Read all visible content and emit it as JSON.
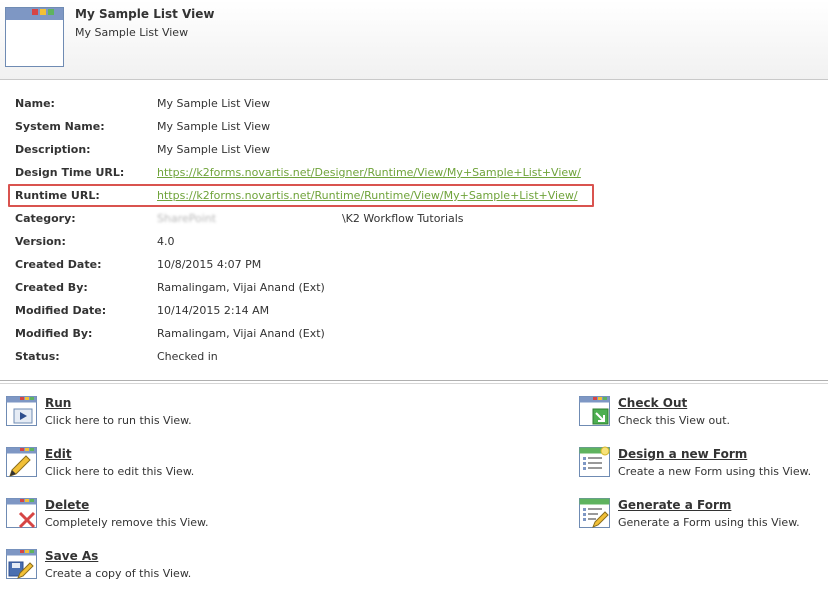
{
  "header": {
    "title": "My Sample List View",
    "subtitle": "My Sample List View"
  },
  "properties": {
    "name": {
      "label": "Name:",
      "value": "My Sample List View"
    },
    "system_name": {
      "label": "System Name:",
      "value": "My Sample List View"
    },
    "description": {
      "label": "Description:",
      "value": "My Sample List View"
    },
    "design_time_url": {
      "label": "Design Time URL:",
      "value": "https://k2forms.novartis.net/Designer/Runtime/View/My+Sample+List+View/"
    },
    "runtime_url": {
      "label": "Runtime URL:",
      "value": "https://k2forms.novartis.net/Runtime/Runtime/View/My+Sample+List+View/"
    },
    "category": {
      "label": "Category:",
      "value_suffix": "\\K2 Workflow Tutorials"
    },
    "version": {
      "label": "Version:",
      "value": "4.0"
    },
    "created_date": {
      "label": "Created Date:",
      "value": "10/8/2015 4:07 PM"
    },
    "created_by": {
      "label": "Created By:",
      "value": "Ramalingam, Vijai Anand (Ext)"
    },
    "modified_date": {
      "label": "Modified Date:",
      "value": "10/14/2015 2:14 AM"
    },
    "modified_by": {
      "label": "Modified By:",
      "value": "Ramalingam, Vijai Anand (Ext)"
    },
    "status": {
      "label": "Status:",
      "value": "Checked in"
    }
  },
  "actions": {
    "run": {
      "title": "Run",
      "desc": "Click here to run this View.",
      "icon": "run-view-icon"
    },
    "edit": {
      "title": "Edit",
      "desc": "Click here to edit this View.",
      "icon": "edit-view-icon"
    },
    "delete": {
      "title": "Delete",
      "desc": "Completely remove this View.",
      "icon": "delete-view-icon"
    },
    "save_as": {
      "title": "Save As",
      "desc": "Create a copy of this View.",
      "icon": "save-as-view-icon"
    },
    "check_out": {
      "title": "Check Out",
      "desc": "Check this View out.",
      "icon": "check-out-icon"
    },
    "design_form": {
      "title": "Design a new Form",
      "desc": "Create a new Form using this View.",
      "icon": "design-form-icon"
    },
    "generate_form": {
      "title": "Generate a Form",
      "desc": "Generate a Form using this View.",
      "icon": "generate-form-icon"
    }
  },
  "colors": {
    "link": "#6fa33a",
    "highlight_border": "#d9534f",
    "icon_bar": "#7e97c4"
  }
}
